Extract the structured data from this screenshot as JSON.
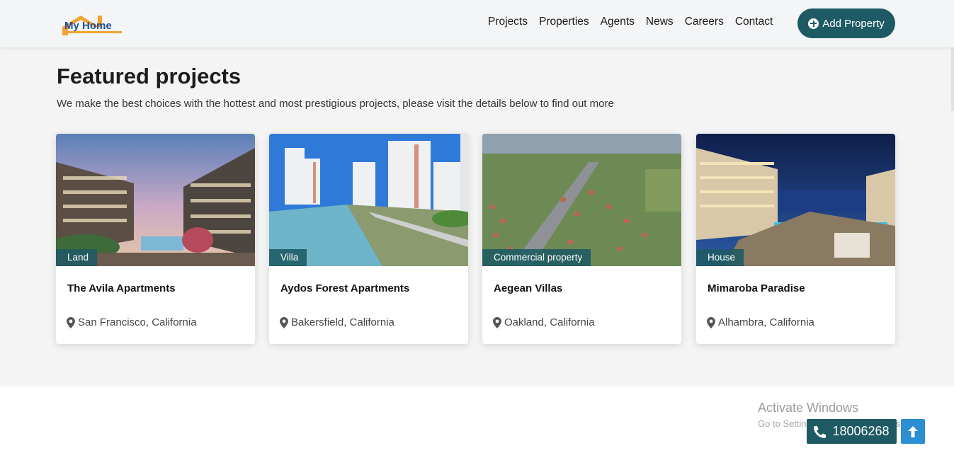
{
  "header": {
    "logo_text": "My Home",
    "nav": [
      "Projects",
      "Properties",
      "Agents",
      "News",
      "Careers",
      "Contact"
    ],
    "add_button": "Add Property"
  },
  "section": {
    "title": "Featured projects",
    "subtitle": "We make the best choices with the hottest and most prestigious projects, please visit the details below to find out more"
  },
  "cards": [
    {
      "tag": "Land",
      "title": "The Avila Apartments",
      "location": "San Francisco, California"
    },
    {
      "tag": "Villa",
      "title": "Aydos Forest Apartments",
      "location": "Bakersfield, California"
    },
    {
      "tag": "Commercial property",
      "title": "Aegean Villas",
      "location": "Oakland, California"
    },
    {
      "tag": "House",
      "title": "Mimaroba Paradise",
      "location": "Alhambra, California"
    }
  ],
  "footer": {
    "phone": "18006268",
    "windows_title": "Activate Windows",
    "windows_sub": "Go to Settings to activate Windows."
  },
  "colors": {
    "primary": "#1e5a63",
    "accent": "#2a8fd3",
    "logo_orange": "#f3a233",
    "logo_blue": "#1f4f9a"
  }
}
